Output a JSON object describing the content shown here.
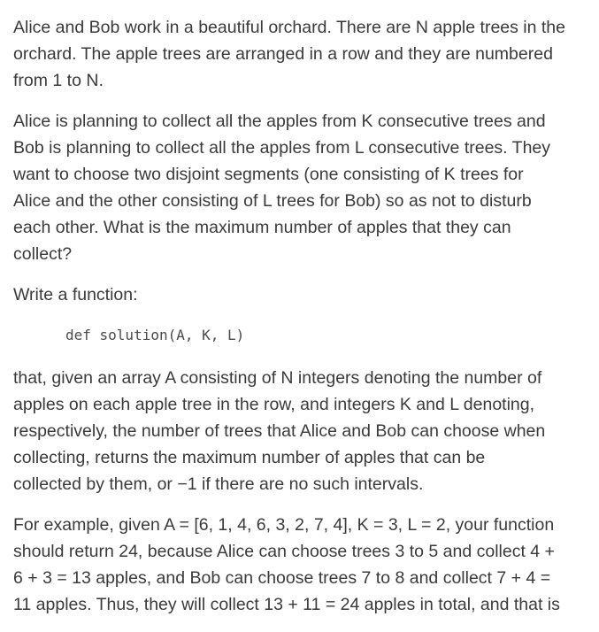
{
  "paragraphs": [
    {
      "lines": [
        "Alice and Bob work in a beautiful orchard. There are N apple trees in the",
        "orchard. The apple trees are arranged in a row and they are numbered",
        "from 1 to N."
      ]
    },
    {
      "lines": [
        "Alice is planning to collect all the apples from K consecutive trees and",
        "Bob is planning to collect all the apples from L consecutive trees. They",
        "want to choose two disjoint segments (one consisting of K trees for",
        "Alice and the other consisting of L trees for Bob) so as not to disturb",
        "each other. What is the maximum number of apples that they can",
        "collect?"
      ]
    },
    {
      "lines": [
        "Write a function:"
      ]
    }
  ],
  "code": "def solution(A, K, L)",
  "paragraphs_after": [
    {
      "lines": [
        "that, given an array A consisting of N integers denoting the number of",
        "apples on each apple tree in the row, and integers K and L denoting,",
        "respectively, the number of trees that Alice and Bob can choose when",
        "collecting, returns the maximum number of apples that can be",
        "collected by them, or −1 if there are no such intervals."
      ]
    },
    {
      "lines": [
        "For example, given A = [6, 1, 4, 6, 3, 2, 7, 4], K = 3, L = 2, your function",
        "should return 24, because Alice can choose trees 3 to 5 and collect 4 +",
        "6 + 3 = 13 apples, and Bob can choose trees 7 to 8 and collect 7 + 4 =",
        "11 apples. Thus, they will collect 13 + 11 = 24 apples in total, and that is"
      ]
    }
  ]
}
